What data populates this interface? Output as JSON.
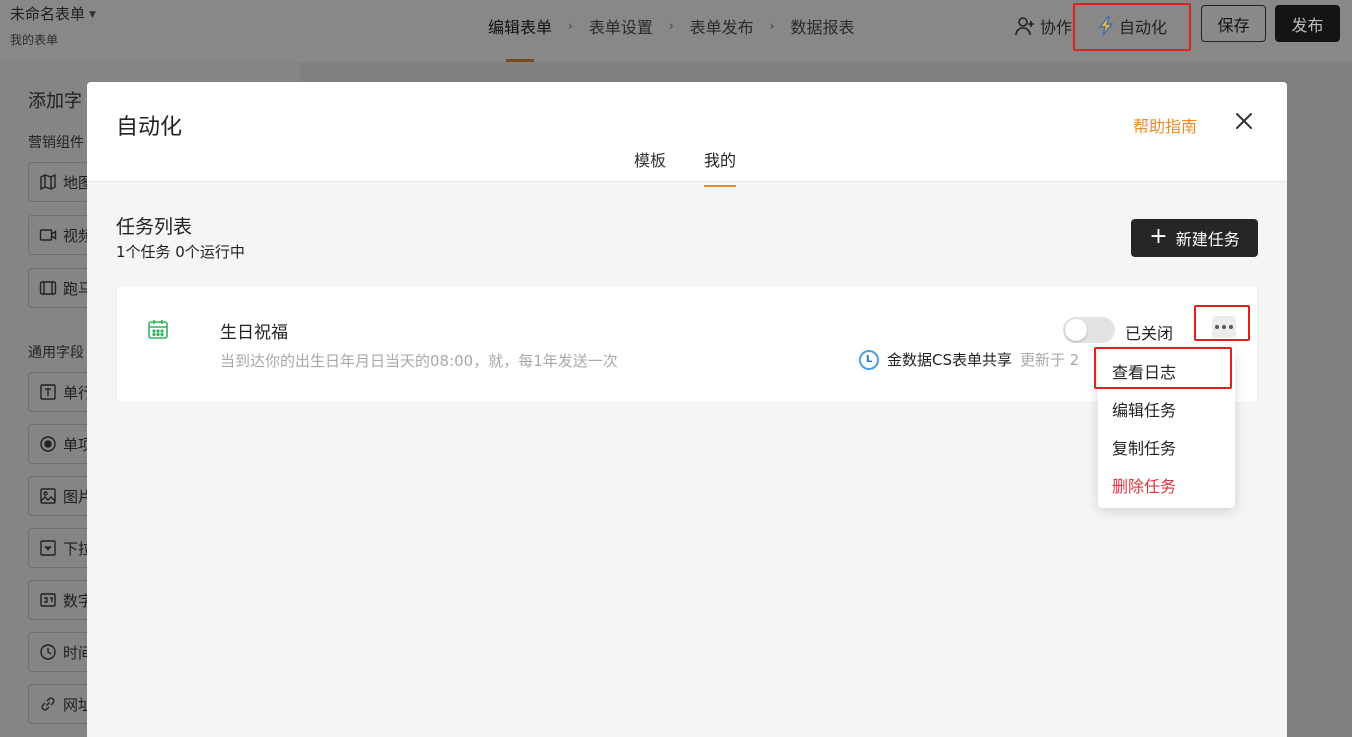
{
  "topbar": {
    "form_name": "未命名表单",
    "form_sub": "我的表单",
    "steps": [
      "编辑表单",
      "表单设置",
      "表单发布",
      "数据报表"
    ],
    "collab_label": "协作",
    "automation_label": "自动化",
    "save_label": "保存",
    "publish_label": "发布"
  },
  "sidebar": {
    "title": "添加字",
    "group_marketing": "营销组件",
    "marketing_items": [
      "地图",
      "视频",
      "跑马"
    ],
    "group_common": "通用字段",
    "common_items": [
      "单行",
      "单项",
      "图片",
      "下拉",
      "数字",
      "时间",
      "网址"
    ]
  },
  "modal": {
    "title": "自动化",
    "help_label": "帮助指南",
    "tabs": [
      "模板",
      "我的"
    ],
    "active_tab": "我的",
    "list_title": "任务列表",
    "list_count": "1个任务 0个运行中",
    "new_task_label": "新建任务",
    "task": {
      "name": "生日祝福",
      "description": "当到达你的出生日年月日当天的08:00，就，每1年发送一次",
      "status_label": "已关闭",
      "enabled": false,
      "source_name": "金数据CS表单共享",
      "source_logo": "L",
      "updated_text": "更新于 2"
    },
    "menu": [
      "查看日志",
      "编辑任务",
      "复制任务",
      "删除任务"
    ]
  },
  "colors": {
    "accent": "#f08a24",
    "danger": "#e0343f",
    "highlight": "#e02020",
    "calendar_icon": "#2db55d"
  }
}
